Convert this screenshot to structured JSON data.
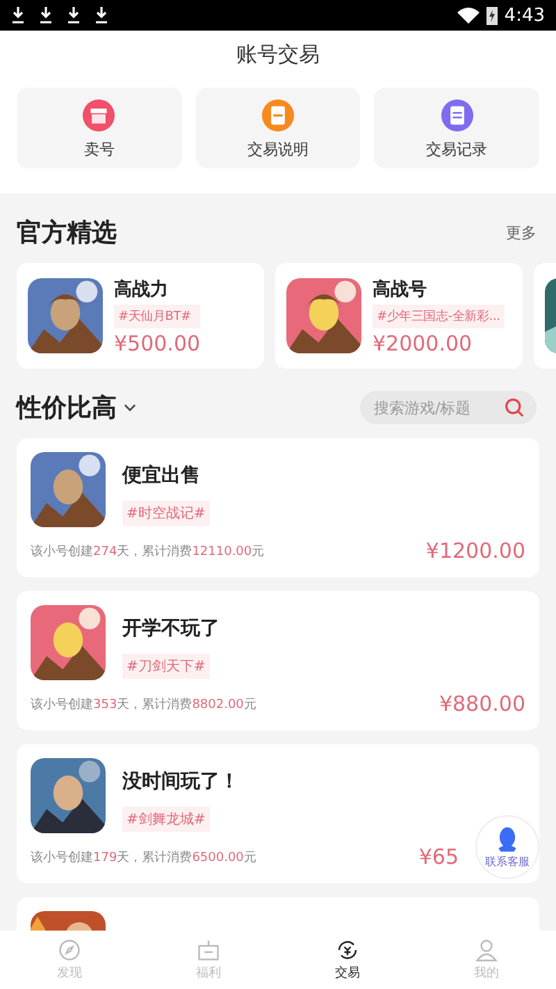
{
  "status_bar": {
    "time": "4:43"
  },
  "header": {
    "title": "账号交易"
  },
  "quick_actions": [
    {
      "label": "卖号",
      "kind": "sell",
      "color": "#f0506a"
    },
    {
      "label": "交易说明",
      "kind": "guide",
      "color": "#f7891f"
    },
    {
      "label": "交易记录",
      "kind": "record",
      "color": "#7d6cf0"
    }
  ],
  "featured": {
    "title": "官方精选",
    "more": "更多",
    "items": [
      {
        "title": "高战力",
        "tag": "#天仙月BT#",
        "price": "¥500.00"
      },
      {
        "title": "高战号",
        "tag": "#少年三国志-全新彩...",
        "price": "¥2000.00"
      }
    ]
  },
  "value": {
    "title": "性价比高",
    "search": {
      "placeholder": "搜索游戏/标题"
    },
    "items": [
      {
        "title": "便宜出售",
        "tag": "#时空战记#",
        "meta": [
          {
            "text": "该小号创建",
            "hl": false
          },
          {
            "text": "274",
            "hl": true
          },
          {
            "text": "天，累计消费",
            "hl": false
          },
          {
            "text": "12110.00",
            "hl": true
          },
          {
            "text": "元",
            "hl": false
          }
        ],
        "price": "¥1200.00"
      },
      {
        "title": "开学不玩了",
        "tag": "#刀剑天下#",
        "meta": [
          {
            "text": "该小号创建",
            "hl": false
          },
          {
            "text": "353",
            "hl": true
          },
          {
            "text": "天，累计消费",
            "hl": false
          },
          {
            "text": "8802.00",
            "hl": true
          },
          {
            "text": "元",
            "hl": false
          }
        ],
        "price": "¥880.00"
      },
      {
        "title": "没时间玩了！",
        "tag": "#剑舞龙城#",
        "meta": [
          {
            "text": "该小号创建",
            "hl": false
          },
          {
            "text": "179",
            "hl": true
          },
          {
            "text": "天，累计消费",
            "hl": false
          },
          {
            "text": "6500.00",
            "hl": true
          },
          {
            "text": "元",
            "hl": false
          }
        ],
        "price": "¥65"
      }
    ]
  },
  "float_button": {
    "label": "联系客服"
  },
  "nav": [
    {
      "label": "发现",
      "kind": "compass",
      "selected": false
    },
    {
      "label": "福利",
      "kind": "gift",
      "selected": false
    },
    {
      "label": "交易",
      "kind": "trade",
      "selected": true
    },
    {
      "label": "我的",
      "kind": "user",
      "selected": false
    }
  ]
}
